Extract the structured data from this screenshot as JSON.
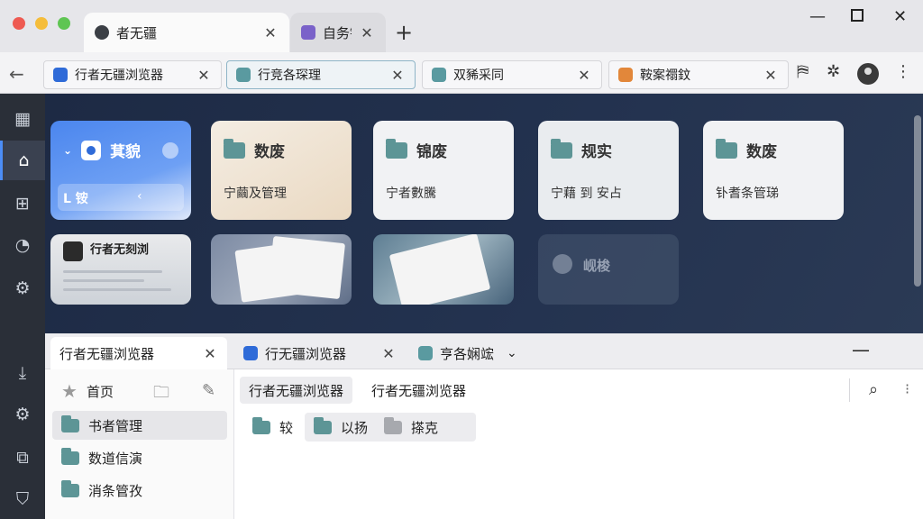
{
  "window_tabs": [
    {
      "label": "者无疆",
      "favicon": "navigation-favicon"
    },
    {
      "label": "自务镪",
      "favicon": "purple-favicon"
    }
  ],
  "page_tabs": [
    {
      "label": "行者无疆浏览器"
    },
    {
      "label": "行竞各琛理"
    },
    {
      "label": "双豨采同"
    },
    {
      "label": "鞍案禤鈫"
    }
  ],
  "dashboard": {
    "cards": [
      {
        "title": "萁貌",
        "subtitle": "L 铵"
      },
      {
        "title": "数废",
        "subtitle": "宁繭及管理"
      },
      {
        "title": "锦废",
        "subtitle": "宁者數騰"
      },
      {
        "title": "规实",
        "subtitle": "宁藉 到 安占"
      },
      {
        "title": "数废",
        "subtitle": "钋耆条管珶"
      }
    ],
    "thumbnails": [
      {
        "title": "行者无刻浏"
      },
      {
        "title": ""
      },
      {
        "title": ""
      },
      {
        "title": "岘梭"
      }
    ]
  },
  "explorer": {
    "tabs": [
      {
        "label": "行者无疆浏览器"
      },
      {
        "label": "行无疆浏览器"
      },
      {
        "label": "亨各娴竤"
      }
    ],
    "sidebar": [
      {
        "label": "首页"
      },
      {
        "label": "书者管理"
      },
      {
        "label": "数道信演"
      },
      {
        "label": "消条管孜"
      }
    ],
    "breadcrumbs": [
      "行者无疆浏览器",
      "行者无疆浏览器"
    ],
    "items": [
      {
        "label": "较"
      },
      {
        "label": "以扬"
      },
      {
        "label": "搽克"
      }
    ]
  },
  "colors": {
    "accent": "#4c8df6",
    "folder": "#5d9596",
    "rail": "#2a2f38",
    "dashboard_bg": "#1d2a44"
  }
}
